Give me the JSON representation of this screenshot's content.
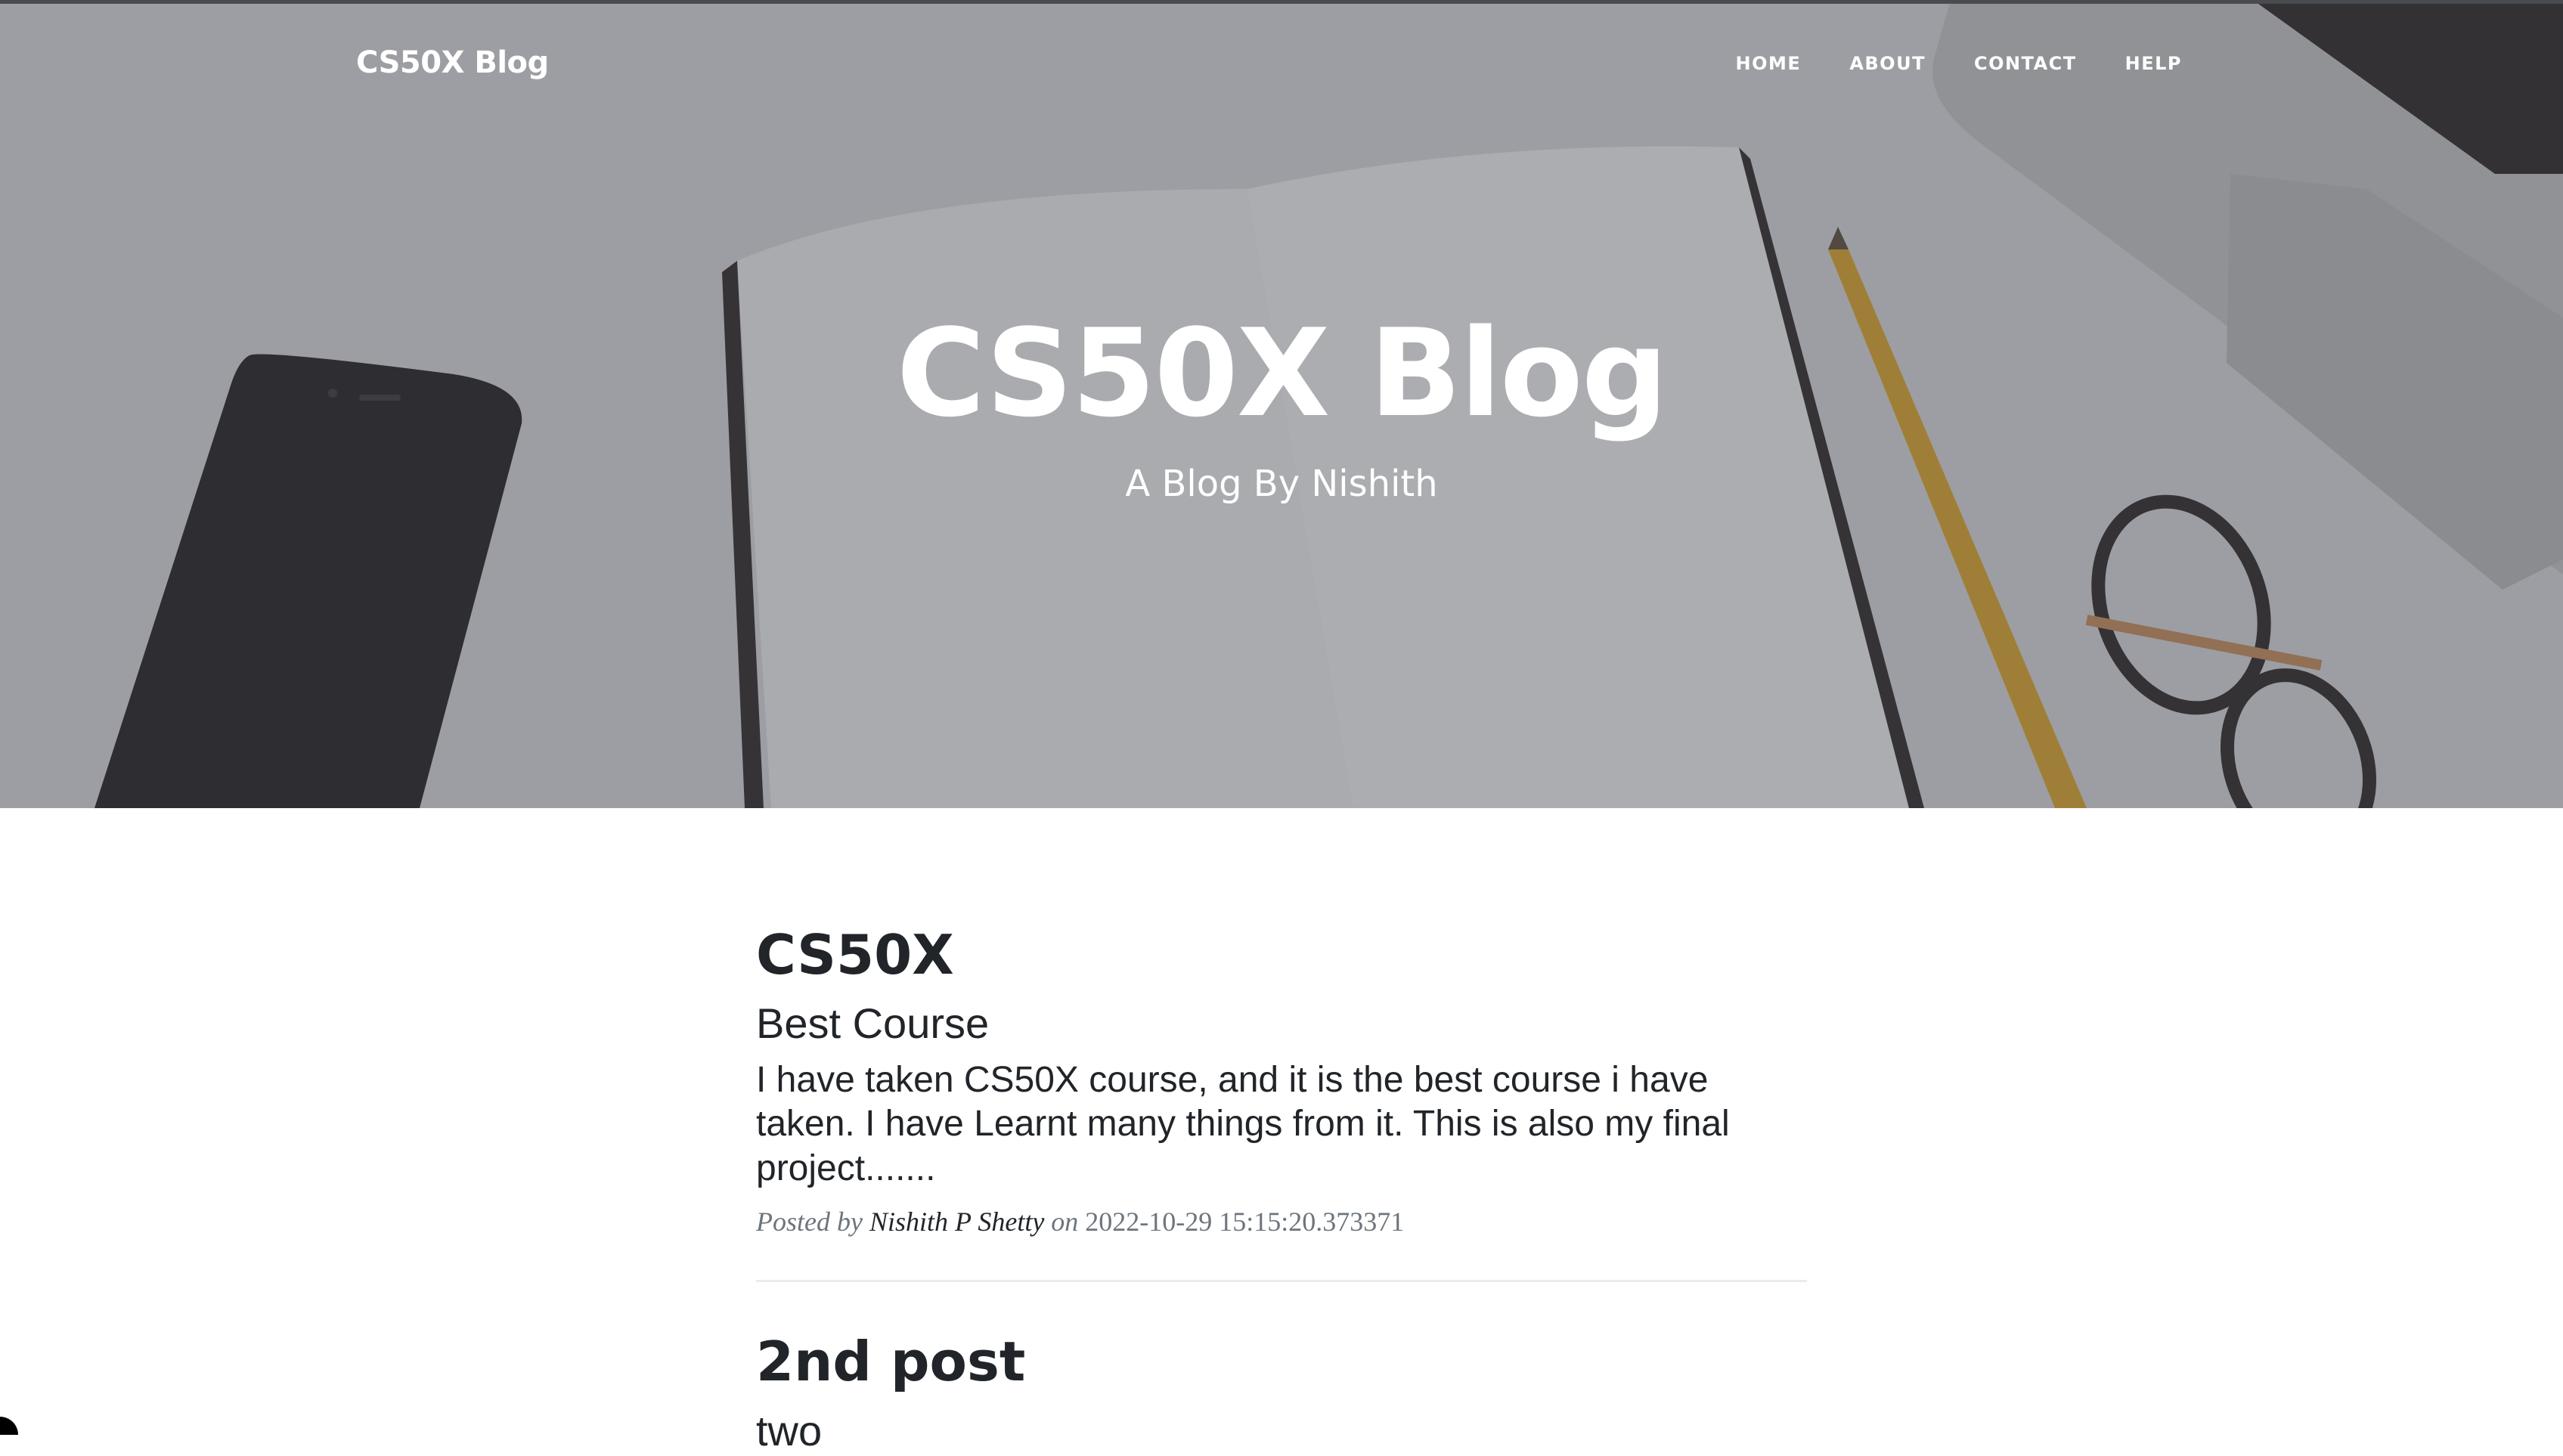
{
  "nav": {
    "brand": "CS50X Blog",
    "links": [
      "HOME",
      "ABOUT",
      "CONTACT",
      "HELP"
    ]
  },
  "hero": {
    "title": "CS50X Blog",
    "subtitle": "A Blog By Nishith"
  },
  "posts": [
    {
      "title": "CS50X",
      "subtitle": "Best Course",
      "body": "I have taken CS50X course, and it is the best course i have taken. I have Learnt many things from it. This is also my final project.......",
      "posted_by_label": "Posted by",
      "author": "Nishith P Shetty",
      "on_label": "on",
      "date": "2022-10-29 15:15:20.373371"
    },
    {
      "title": "2nd post",
      "subtitle": "two"
    }
  ],
  "colors": {
    "text": "#212529",
    "meta": "#6c757d",
    "divider": "#e9ecef",
    "white": "#ffffff"
  }
}
